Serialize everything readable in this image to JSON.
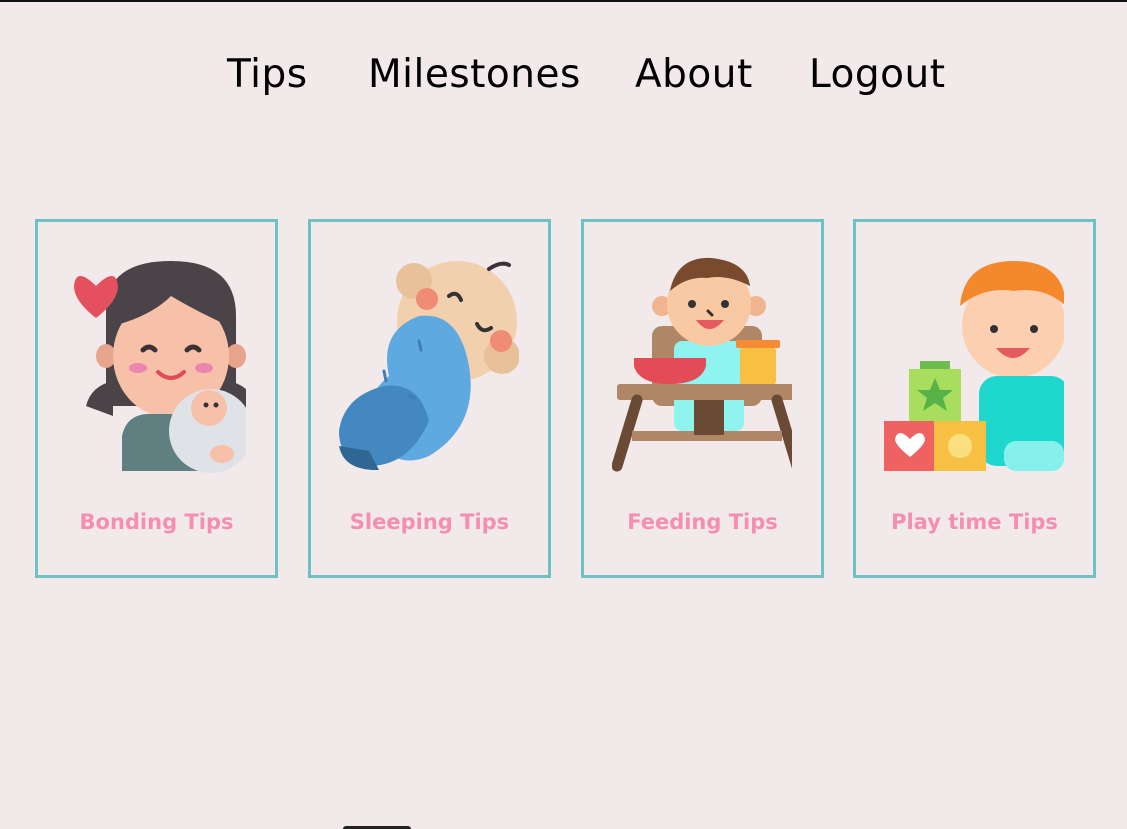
{
  "nav": {
    "tips": "Tips",
    "milestones": "Milestones",
    "about": "About",
    "logout": "Logout"
  },
  "cards": [
    {
      "label": "Bonding Tips",
      "icon": "mother-holding-baby-icon"
    },
    {
      "label": "Sleeping Tips",
      "icon": "swaddled-sleeping-baby-icon"
    },
    {
      "label": "Feeding Tips",
      "icon": "baby-high-chair-icon"
    },
    {
      "label": "Play time Tips",
      "icon": "child-with-blocks-icon"
    }
  ],
  "colors": {
    "background": "#f1e9ea",
    "card_border": "#6fc1c3",
    "card_label": "#f48fb1",
    "nav_text": "#000000"
  }
}
